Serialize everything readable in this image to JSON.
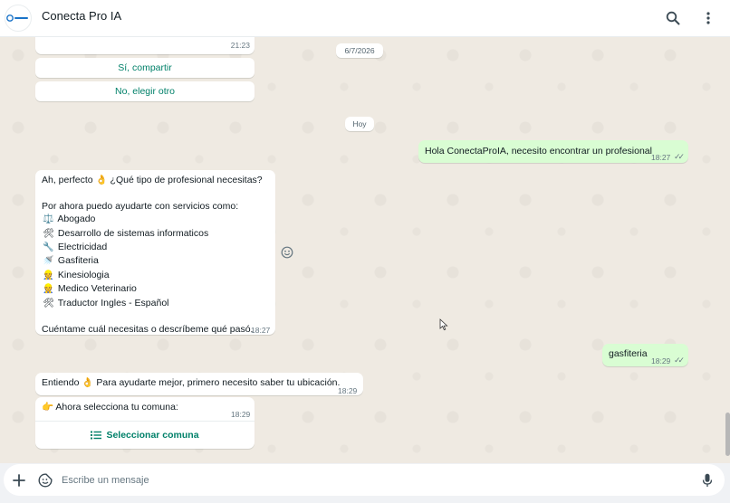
{
  "header": {
    "title": "Conecta Pro IA",
    "avatar_icon": "conecta-logo-icon",
    "search_icon": "search-icon",
    "menu_icon": "more-vertical-icon"
  },
  "messages": {
    "top_partial": {
      "time": "21:23"
    },
    "buttons_top": [
      {
        "label": "Sí, compartir"
      },
      {
        "label": "No, elegir otro"
      }
    ],
    "date_chips": [
      "6/7/2026",
      "Hoy"
    ],
    "outgoing_1": {
      "text": "Hola ConectaProIA, necesito encontrar un profesional",
      "time": "18:27"
    },
    "incoming_1": {
      "intro": "Ah, perfecto 👌 ¿Qué tipo de profesional necesitas?",
      "lead": "Por ahora puedo ayudarte con servicios como:",
      "services": [
        {
          "icon": "⚖️",
          "icon_name": "scales-icon",
          "label": "Abogado"
        },
        {
          "icon": "🛠",
          "icon_name": "tools-icon",
          "label": "Desarrollo de sistemas informaticos"
        },
        {
          "icon": "🔧",
          "icon_name": "wrench-icon",
          "label": "Electricidad"
        },
        {
          "icon": "🚿",
          "icon_name": "shower-icon",
          "label": "Gasfiteria"
        },
        {
          "icon": "👷",
          "icon_name": "worker-icon",
          "label": "Kinesiologia"
        },
        {
          "icon": "👷",
          "icon_name": "worker-icon",
          "label": "Medico Veterinario"
        },
        {
          "icon": "🛠",
          "icon_name": "tools-icon",
          "label": "Traductor Ingles - Español"
        }
      ],
      "closing": "Cuéntame cuál necesitas o descríbeme qué pasó.",
      "time": "18:27"
    },
    "outgoing_2": {
      "text": "gasfiteria",
      "time": "18:29"
    },
    "incoming_2": {
      "text": "Entiendo 👌 Para ayudarte mejor, primero necesito saber tu ubicación.",
      "time": "18:29"
    },
    "incoming_3": {
      "text": "👉 Ahora selecciona tu comuna:",
      "time": "18:29",
      "list_button": "Seleccionar comuna"
    }
  },
  "composer": {
    "placeholder": "Escribe un mensaje",
    "attach_icon": "plus-icon",
    "sticker_icon": "sticker-icon",
    "mic_icon": "microphone-icon"
  },
  "colors": {
    "chat_bg": "#efeae2",
    "outgoing_bubble": "#d9fdd3",
    "accent": "#008069"
  }
}
